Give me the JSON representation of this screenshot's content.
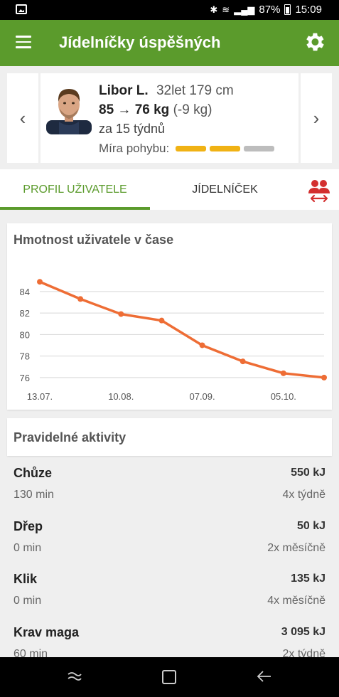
{
  "status_bar": {
    "battery": "87%",
    "time": "15:09"
  },
  "app_bar": {
    "title": "Jídelníčky úspěšných"
  },
  "profile": {
    "name": "Libor L.",
    "age_height": "32let  179 cm",
    "weight_change": "85 → 76 kg",
    "weight_delta": "(-9 kg)",
    "duration": "za 15 týdnů",
    "activity_label": "Míra pohybu:",
    "activity_level": 2,
    "activity_max": 3,
    "colors": {
      "active": "#f0b214",
      "inactive": "#bdbdbd"
    }
  },
  "tabs": {
    "profile": "PROFIL UŽIVATELE",
    "menu": "JÍDELNÍČEK"
  },
  "chart_title": "Hmotnost uživatele v čase",
  "chart_data": {
    "type": "line",
    "title": "Hmotnost uživatele v čase",
    "x": [
      "2017-07-13",
      "2017-07-27",
      "2017-08-10",
      "2017-08-24",
      "2017-09-07",
      "2017-09-21",
      "2017-10-05",
      "2017-10-19"
    ],
    "y": [
      84.9,
      83.3,
      81.9,
      81.3,
      79.0,
      77.5,
      76.4,
      76.0
    ],
    "x_ticks": [
      "13.07.",
      "10.08.",
      "07.09.",
      "05.10."
    ],
    "y_ticks": [
      76,
      78,
      80,
      82,
      84
    ],
    "ylim": [
      75,
      86.5
    ],
    "color": "#ee6d35",
    "grid": true
  },
  "activities": {
    "title": "Pravidelné aktivity",
    "items": [
      {
        "name": "Chůze",
        "energy": "550 kJ",
        "duration": "130 min",
        "frequency": "4x týdně"
      },
      {
        "name": "Dřep",
        "energy": "50 kJ",
        "duration": "0 min",
        "frequency": "2x měsíčně"
      },
      {
        "name": "Klik",
        "energy": "135 kJ",
        "duration": "0 min",
        "frequency": "4x měsíčně"
      },
      {
        "name": "Krav maga",
        "energy": "3 095 kJ",
        "duration": "60 min",
        "frequency": "2x týdně"
      }
    ]
  },
  "theme": {
    "primary": "#5b9b2c",
    "accent_red": "#d32f2f"
  }
}
